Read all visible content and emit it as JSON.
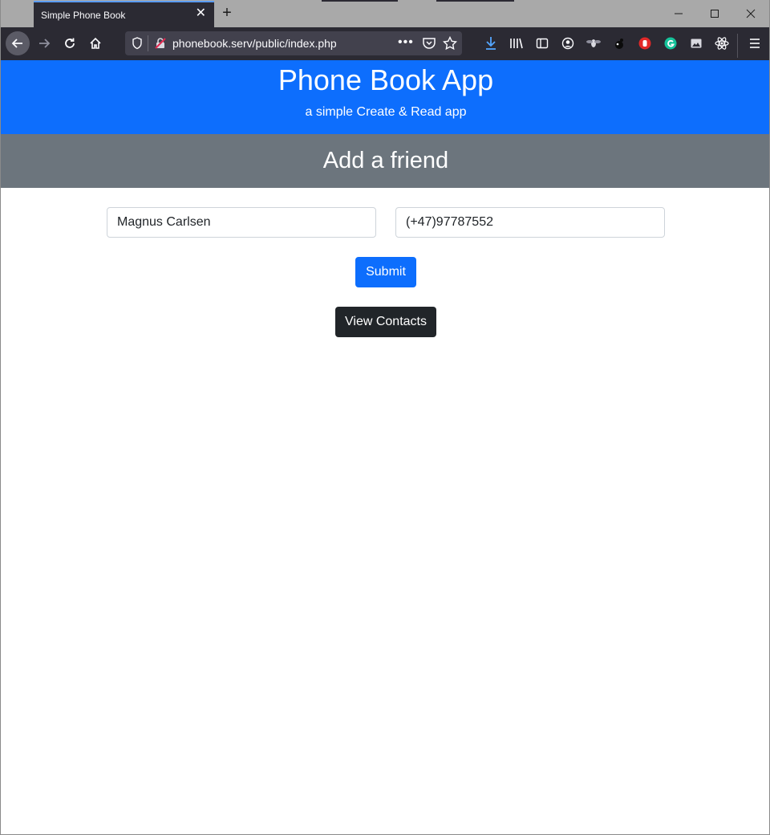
{
  "browser": {
    "tab_title": "Simple Phone Book",
    "url": "phonebook.serv/public/index.php"
  },
  "header": {
    "title": "Phone Book App",
    "subtitle": "a simple Create & Read app"
  },
  "form": {
    "heading": "Add a friend",
    "name_value": "Magnus Carlsen",
    "phone_value": "(+47)97787552",
    "submit_label": "Submit",
    "view_label": "View Contacts"
  },
  "colors": {
    "primary": "#0d6efd",
    "secondary": "#6c757d",
    "dark": "#212529",
    "browser_chrome": "#2b2a33"
  }
}
